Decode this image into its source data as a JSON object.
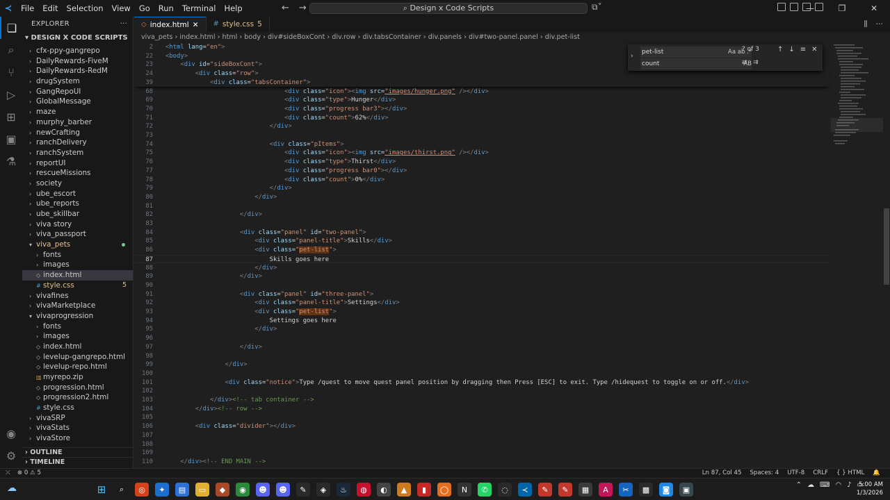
{
  "menu": [
    "File",
    "Edit",
    "Selection",
    "View",
    "Go",
    "Run",
    "Terminal",
    "Help"
  ],
  "command_center": "Design x Code Scripts",
  "explorer": {
    "title": "EXPLORER",
    "root": "DESIGN X CODE SCRIPTS",
    "items": [
      {
        "label": "cfx-ppy-gangrepo",
        "depth": 1,
        "type": "folder"
      },
      {
        "label": "DailyRewards-FiveM",
        "depth": 1,
        "type": "folder"
      },
      {
        "label": "DailyRewards-RedM",
        "depth": 1,
        "type": "folder"
      },
      {
        "label": "drugSystem",
        "depth": 1,
        "type": "folder"
      },
      {
        "label": "GangRepoUI",
        "depth": 1,
        "type": "folder"
      },
      {
        "label": "GlobalMessage",
        "depth": 1,
        "type": "folder"
      },
      {
        "label": "maze",
        "depth": 1,
        "type": "folder"
      },
      {
        "label": "murphy_barber",
        "depth": 1,
        "type": "folder"
      },
      {
        "label": "newCrafting",
        "depth": 1,
        "type": "folder"
      },
      {
        "label": "ranchDelivery",
        "depth": 1,
        "type": "folder"
      },
      {
        "label": "ranchSystem",
        "depth": 1,
        "type": "folder"
      },
      {
        "label": "reportUI",
        "depth": 1,
        "type": "folder"
      },
      {
        "label": "rescueMissions",
        "depth": 1,
        "type": "folder"
      },
      {
        "label": "society",
        "depth": 1,
        "type": "folder"
      },
      {
        "label": "ube_escort",
        "depth": 1,
        "type": "folder"
      },
      {
        "label": "ube_reports",
        "depth": 1,
        "type": "folder"
      },
      {
        "label": "ube_skillbar",
        "depth": 1,
        "type": "folder"
      },
      {
        "label": "viva story",
        "depth": 1,
        "type": "folder"
      },
      {
        "label": "viva_passport",
        "depth": 1,
        "type": "folder"
      },
      {
        "label": "viva_pets",
        "depth": 1,
        "type": "folder-open",
        "color": "orange",
        "dot": true
      },
      {
        "label": "fonts",
        "depth": 2,
        "type": "folder"
      },
      {
        "label": "images",
        "depth": 2,
        "type": "folder"
      },
      {
        "label": "index.html",
        "depth": 2,
        "type": "html",
        "selected": true
      },
      {
        "label": "style.css",
        "depth": 2,
        "type": "css",
        "color": "orange",
        "badge": "5"
      },
      {
        "label": "vivafines",
        "depth": 1,
        "type": "folder"
      },
      {
        "label": "vivaMarketplace",
        "depth": 1,
        "type": "folder"
      },
      {
        "label": "vivaprogression",
        "depth": 1,
        "type": "folder-open"
      },
      {
        "label": "fonts",
        "depth": 2,
        "type": "folder"
      },
      {
        "label": "images",
        "depth": 2,
        "type": "folder"
      },
      {
        "label": "index.html",
        "depth": 2,
        "type": "html"
      },
      {
        "label": "levelup-gangrepo.html",
        "depth": 2,
        "type": "html"
      },
      {
        "label": "levelup-repo.html",
        "depth": 2,
        "type": "html"
      },
      {
        "label": "myrepo.zip",
        "depth": 2,
        "type": "zip"
      },
      {
        "label": "progression.html",
        "depth": 2,
        "type": "html"
      },
      {
        "label": "progression2.html",
        "depth": 2,
        "type": "html"
      },
      {
        "label": "style.css",
        "depth": 2,
        "type": "css"
      },
      {
        "label": "vivaSRP",
        "depth": 1,
        "type": "folder"
      },
      {
        "label": "vivaStats",
        "depth": 1,
        "type": "folder"
      },
      {
        "label": "vivaStore",
        "depth": 1,
        "type": "folder"
      }
    ],
    "outline": "OUTLINE",
    "timeline": "TIMELINE"
  },
  "tabs": [
    {
      "label": "index.html",
      "active": true,
      "icon": "html-icon"
    },
    {
      "label": "style.css",
      "badge": "5",
      "icon": "css-icon"
    }
  ],
  "breadcrumb": [
    "viva_pets",
    "index.html",
    "html",
    "body",
    "div#sideBoxCont",
    "div.row",
    "div.tabsContainer",
    "div.panels",
    "div#two-panel.panel",
    "div.pet-list"
  ],
  "find_widget": {
    "find": "pet-list",
    "replace": "count",
    "count": "? of 3",
    "opts_find": "Aa  ab  .*",
    "opts_replace": "AB"
  },
  "code_lines": [
    {
      "n": "2",
      "html": "<span class=\"t\">&lt;</span><span class=\"tn\">html</span> <span class=\"an\">lang</span><span class=\"tx\">=</span><span class=\"av\">\"en\"</span><span class=\"t\">&gt;</span>",
      "sticky": true
    },
    {
      "n": "22",
      "html": "<span class=\"t\">&lt;</span><span class=\"tn\">body</span><span class=\"t\">&gt;</span>",
      "sticky": true
    },
    {
      "n": "23",
      "html": "    <span class=\"t\">&lt;</span><span class=\"tn\">div</span> <span class=\"an\">id</span><span class=\"tx\">=</span><span class=\"av\">\"sideBoxCont\"</span><span class=\"t\">&gt;</span>",
      "sticky": true
    },
    {
      "n": "24",
      "html": "        <span class=\"t\">&lt;</span><span class=\"tn\">div</span> <span class=\"an\">class</span><span class=\"tx\">=</span><span class=\"av\">\"row\"</span><span class=\"t\">&gt;</span>",
      "sticky": true
    },
    {
      "n": "39",
      "html": "            <span class=\"t\">&lt;</span><span class=\"tn\">div</span> <span class=\"an\">class</span><span class=\"tx\">=</span><span class=\"av\">\"tabsContainer\"</span><span class=\"t\">&gt;</span>",
      "sticky": true
    },
    {
      "n": "68",
      "html": "                                <span class=\"t\">&lt;</span><span class=\"tn\">div</span> <span class=\"an\">class</span><span class=\"tx\">=</span><span class=\"av\">\"icon\"</span><span class=\"t\">&gt;&lt;</span><span class=\"tn\">img</span> <span class=\"an\">src</span><span class=\"tx\">=</span><span class=\"av u\">\"images/hunger.png\"</span> <span class=\"t\">/&gt;&lt;/</span><span class=\"tn\">div</span><span class=\"t\">&gt;</span>"
    },
    {
      "n": "69",
      "html": "                                <span class=\"t\">&lt;</span><span class=\"tn\">div</span> <span class=\"an\">class</span><span class=\"tx\">=</span><span class=\"av\">\"type\"</span><span class=\"t\">&gt;</span><span class=\"tx\">Hunger</span><span class=\"t\">&lt;/</span><span class=\"tn\">div</span><span class=\"t\">&gt;</span>"
    },
    {
      "n": "70",
      "html": "                                <span class=\"t\">&lt;</span><span class=\"tn\">div</span> <span class=\"an\">class</span><span class=\"tx\">=</span><span class=\"av\">\"progress bar3\"</span><span class=\"t\">&gt;&lt;/</span><span class=\"tn\">div</span><span class=\"t\">&gt;</span>"
    },
    {
      "n": "71",
      "html": "                                <span class=\"t\">&lt;</span><span class=\"tn\">div</span> <span class=\"an\">class</span><span class=\"tx\">=</span><span class=\"av\">\"count\"</span><span class=\"t\">&gt;</span><span class=\"tx\">62%</span><span class=\"t\">&lt;/</span><span class=\"tn\">div</span><span class=\"t\">&gt;</span>"
    },
    {
      "n": "72",
      "html": "                            <span class=\"t\">&lt;/</span><span class=\"tn\">div</span><span class=\"t\">&gt;</span>"
    },
    {
      "n": "73",
      "html": ""
    },
    {
      "n": "74",
      "html": "                            <span class=\"t\">&lt;</span><span class=\"tn\">div</span> <span class=\"an\">class</span><span class=\"tx\">=</span><span class=\"av\">\"pItems\"</span><span class=\"t\">&gt;</span>"
    },
    {
      "n": "75",
      "html": "                                <span class=\"t\">&lt;</span><span class=\"tn\">div</span> <span class=\"an\">class</span><span class=\"tx\">=</span><span class=\"av\">\"icon\"</span><span class=\"t\">&gt;&lt;</span><span class=\"tn\">img</span> <span class=\"an\">src</span><span class=\"tx\">=</span><span class=\"av u\">\"images/thirst.png\"</span> <span class=\"t\">/&gt;&lt;/</span><span class=\"tn\">div</span><span class=\"t\">&gt;</span>"
    },
    {
      "n": "76",
      "html": "                                <span class=\"t\">&lt;</span><span class=\"tn\">div</span> <span class=\"an\">class</span><span class=\"tx\">=</span><span class=\"av\">\"type\"</span><span class=\"t\">&gt;</span><span class=\"tx\">Thirst</span><span class=\"t\">&lt;/</span><span class=\"tn\">div</span><span class=\"t\">&gt;</span>"
    },
    {
      "n": "77",
      "html": "                                <span class=\"t\">&lt;</span><span class=\"tn\">div</span> <span class=\"an\">class</span><span class=\"tx\">=</span><span class=\"av\">\"progress bar0\"</span><span class=\"t\">&gt;&lt;/</span><span class=\"tn\">div</span><span class=\"t\">&gt;</span>"
    },
    {
      "n": "78",
      "html": "                                <span class=\"t\">&lt;</span><span class=\"tn\">div</span> <span class=\"an\">class</span><span class=\"tx\">=</span><span class=\"av\">\"count\"</span><span class=\"t\">&gt;</span><span class=\"tx\">0%</span><span class=\"t\">&lt;/</span><span class=\"tn\">div</span><span class=\"t\">&gt;</span>"
    },
    {
      "n": "79",
      "html": "                            <span class=\"t\">&lt;/</span><span class=\"tn\">div</span><span class=\"t\">&gt;</span>"
    },
    {
      "n": "80",
      "html": "                        <span class=\"t\">&lt;/</span><span class=\"tn\">div</span><span class=\"t\">&gt;</span>"
    },
    {
      "n": "81",
      "html": ""
    },
    {
      "n": "82",
      "html": "                    <span class=\"t\">&lt;/</span><span class=\"tn\">div</span><span class=\"t\">&gt;</span>"
    },
    {
      "n": "83",
      "html": ""
    },
    {
      "n": "84",
      "html": "                    <span class=\"t\">&lt;</span><span class=\"tn\">div</span> <span class=\"an\">class</span><span class=\"tx\">=</span><span class=\"av\">\"panel\"</span> <span class=\"an\">id</span><span class=\"tx\">=</span><span class=\"av\">\"two-panel\"</span><span class=\"t\">&gt;</span>"
    },
    {
      "n": "85",
      "html": "                        <span class=\"t\">&lt;</span><span class=\"tn\">div</span> <span class=\"an\">class</span><span class=\"tx\">=</span><span class=\"av\">\"panel-title\"</span><span class=\"t\">&gt;</span><span class=\"tx\">Skills</span><span class=\"t\">&lt;/</span><span class=\"tn\">div</span><span class=\"t\">&gt;</span>"
    },
    {
      "n": "86",
      "html": "                        <span class=\"t\">&lt;</span><span class=\"tn\">div</span> <span class=\"an\">class</span><span class=\"tx\">=</span><span class=\"av\">\"<span class=\"hl\">pet-list</span>\"</span><span class=\"t\">&gt;</span>"
    },
    {
      "n": "87",
      "html": "                            <span class=\"tx\">Skills goes here</span>",
      "current": true
    },
    {
      "n": "88",
      "html": "                        <span class=\"t\">&lt;/</span><span class=\"tn\">div</span><span class=\"t\">&gt;</span>"
    },
    {
      "n": "89",
      "html": "                    <span class=\"t\">&lt;/</span><span class=\"tn\">div</span><span class=\"t\">&gt;</span>"
    },
    {
      "n": "90",
      "html": ""
    },
    {
      "n": "91",
      "html": "                    <span class=\"t\">&lt;</span><span class=\"tn\">div</span> <span class=\"an\">class</span><span class=\"tx\">=</span><span class=\"av\">\"panel\"</span> <span class=\"an\">id</span><span class=\"tx\">=</span><span class=\"av\">\"three-panel\"</span><span class=\"t\">&gt;</span>"
    },
    {
      "n": "92",
      "html": "                        <span class=\"t\">&lt;</span><span class=\"tn\">div</span> <span class=\"an\">class</span><span class=\"tx\">=</span><span class=\"av\">\"panel-title\"</span><span class=\"t\">&gt;</span><span class=\"tx\">Settings</span><span class=\"t\">&lt;/</span><span class=\"tn\">div</span><span class=\"t\">&gt;</span>"
    },
    {
      "n": "93",
      "html": "                        <span class=\"t\">&lt;</span><span class=\"tn\">div</span> <span class=\"an\">class</span><span class=\"tx\">=</span><span class=\"av\">\"<span class=\"hl\">pet-list</span>\"</span><span class=\"t\">&gt;</span>"
    },
    {
      "n": "94",
      "html": "                            <span class=\"tx\">Settings goes here</span>"
    },
    {
      "n": "95",
      "html": "                        <span class=\"t\">&lt;/</span><span class=\"tn\">div</span><span class=\"t\">&gt;</span>"
    },
    {
      "n": "96",
      "html": ""
    },
    {
      "n": "97",
      "html": "                    <span class=\"t\">&lt;/</span><span class=\"tn\">div</span><span class=\"t\">&gt;</span>"
    },
    {
      "n": "98",
      "html": ""
    },
    {
      "n": "99",
      "html": "                <span class=\"t\">&lt;/</span><span class=\"tn\">div</span><span class=\"t\">&gt;</span>"
    },
    {
      "n": "100",
      "html": ""
    },
    {
      "n": "101",
      "html": "                <span class=\"t\">&lt;</span><span class=\"tn\">div</span> <span class=\"an\">class</span><span class=\"tx\">=</span><span class=\"av\">\"notice\"</span><span class=\"t\">&gt;</span><span class=\"tx\">Type /quest to move quest panel position by dragging then Press [ESC] to exit. Type /hidequest to toggle on or off.</span><span class=\"t\">&lt;/</span><span class=\"tn\">div</span><span class=\"t\">&gt;</span>"
    },
    {
      "n": "102",
      "html": ""
    },
    {
      "n": "103",
      "html": "            <span class=\"t\">&lt;/</span><span class=\"tn\">div</span><span class=\"t\">&gt;</span><span class=\"cm\">&lt;!-- tab container --&gt;</span>"
    },
    {
      "n": "104",
      "html": "        <span class=\"t\">&lt;/</span><span class=\"tn\">div</span><span class=\"t\">&gt;</span><span class=\"cm\">&lt;!-- row --&gt;</span>"
    },
    {
      "n": "105",
      "html": ""
    },
    {
      "n": "106",
      "html": "        <span class=\"t\">&lt;</span><span class=\"tn\">div</span> <span class=\"an\">class</span><span class=\"tx\">=</span><span class=\"av\">\"divider\"</span><span class=\"t\">&gt;&lt;/</span><span class=\"tn\">div</span><span class=\"t\">&gt;</span>"
    },
    {
      "n": "107",
      "html": ""
    },
    {
      "n": "108",
      "html": ""
    },
    {
      "n": "109",
      "html": ""
    },
    {
      "n": "110",
      "html": "    <span class=\"t\">&lt;/</span><span class=\"tn\">div</span><span class=\"t\">&gt;</span><span class=\"cm\">&lt;!-- END MAIN --&gt;</span>"
    }
  ],
  "status": {
    "problems": "0",
    "warnings": "5",
    "position": "Ln 87, Col 45",
    "spaces": "Spaces: 4",
    "encoding": "UTF-8",
    "eol": "CRLF",
    "language": "HTML"
  },
  "clock": {
    "time": "5:00 AM",
    "date": "1/3/2026"
  },
  "colors": {
    "accent": "#0078d4",
    "modified": "#e2c08d",
    "find_highlight": "#623315"
  }
}
